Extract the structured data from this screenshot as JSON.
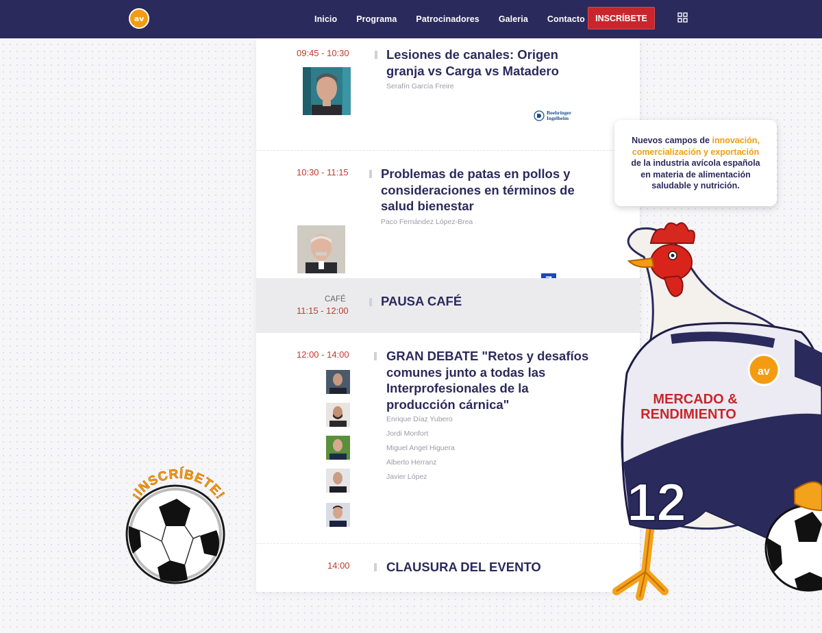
{
  "nav": {
    "logo_text": "av",
    "links": [
      "Inicio",
      "Programa",
      "Patrocinadores",
      "Galeria",
      "Contacto"
    ],
    "cta": "INSCRÍBETE"
  },
  "schedule": [
    {
      "time": "09:45 - 10:30",
      "title_lines": [
        "Lesiones de canales: Origen",
        "granja vs Carga vs Matadero"
      ],
      "speakers": [
        "Serafín García Freire"
      ],
      "sponsor": [
        "Boehringer",
        "Ingelheim"
      ]
    },
    {
      "time": "10:30 - 11:15",
      "title_lines": [
        "Problemas de patas en pollos y",
        "consideraciones en términos de",
        "salud bienestar"
      ],
      "speakers": [
        "Paco Fernández López-Brea"
      ],
      "sponsor_badge": "Z"
    },
    {
      "label": "CAFÉ",
      "time": "11:15 - 12:00",
      "title_lines": [
        "PAUSA CAFÉ"
      ]
    },
    {
      "time": "12:00 - 14:00",
      "title_lines": [
        "GRAN DEBATE \"Retos y desafíos",
        "comunes junto a todas las",
        "Interprofesionales de la",
        "producción cárnica\""
      ],
      "speakers": [
        "Enrique Díaz Yubero",
        "Jordi Monfort",
        "Miguel Angel Higuera",
        "Alberto Herranz",
        "Javier López"
      ]
    },
    {
      "time": "14:00",
      "title_lines": [
        "CLAUSURA DEL EVENTO"
      ]
    }
  ],
  "callout": {
    "line1_pre": "Nuevos campos de ",
    "line1_hl": "innovación,",
    "line2_hl": "comercialización y exportación",
    "line3": "de la industria avícola española",
    "line4": "en materia de alimentación",
    "line5": "saludable y nutrición."
  },
  "ball_badge": "¡INSCRÍBETE!",
  "mascot": {
    "shirt_line1": "MERCADO &",
    "shirt_line2": "RENDIMIENTO",
    "number": "12",
    "chest_logo": "av"
  },
  "colors": {
    "navy": "#2b2a5c",
    "red": "#c8262c",
    "orange": "#f39c12"
  }
}
